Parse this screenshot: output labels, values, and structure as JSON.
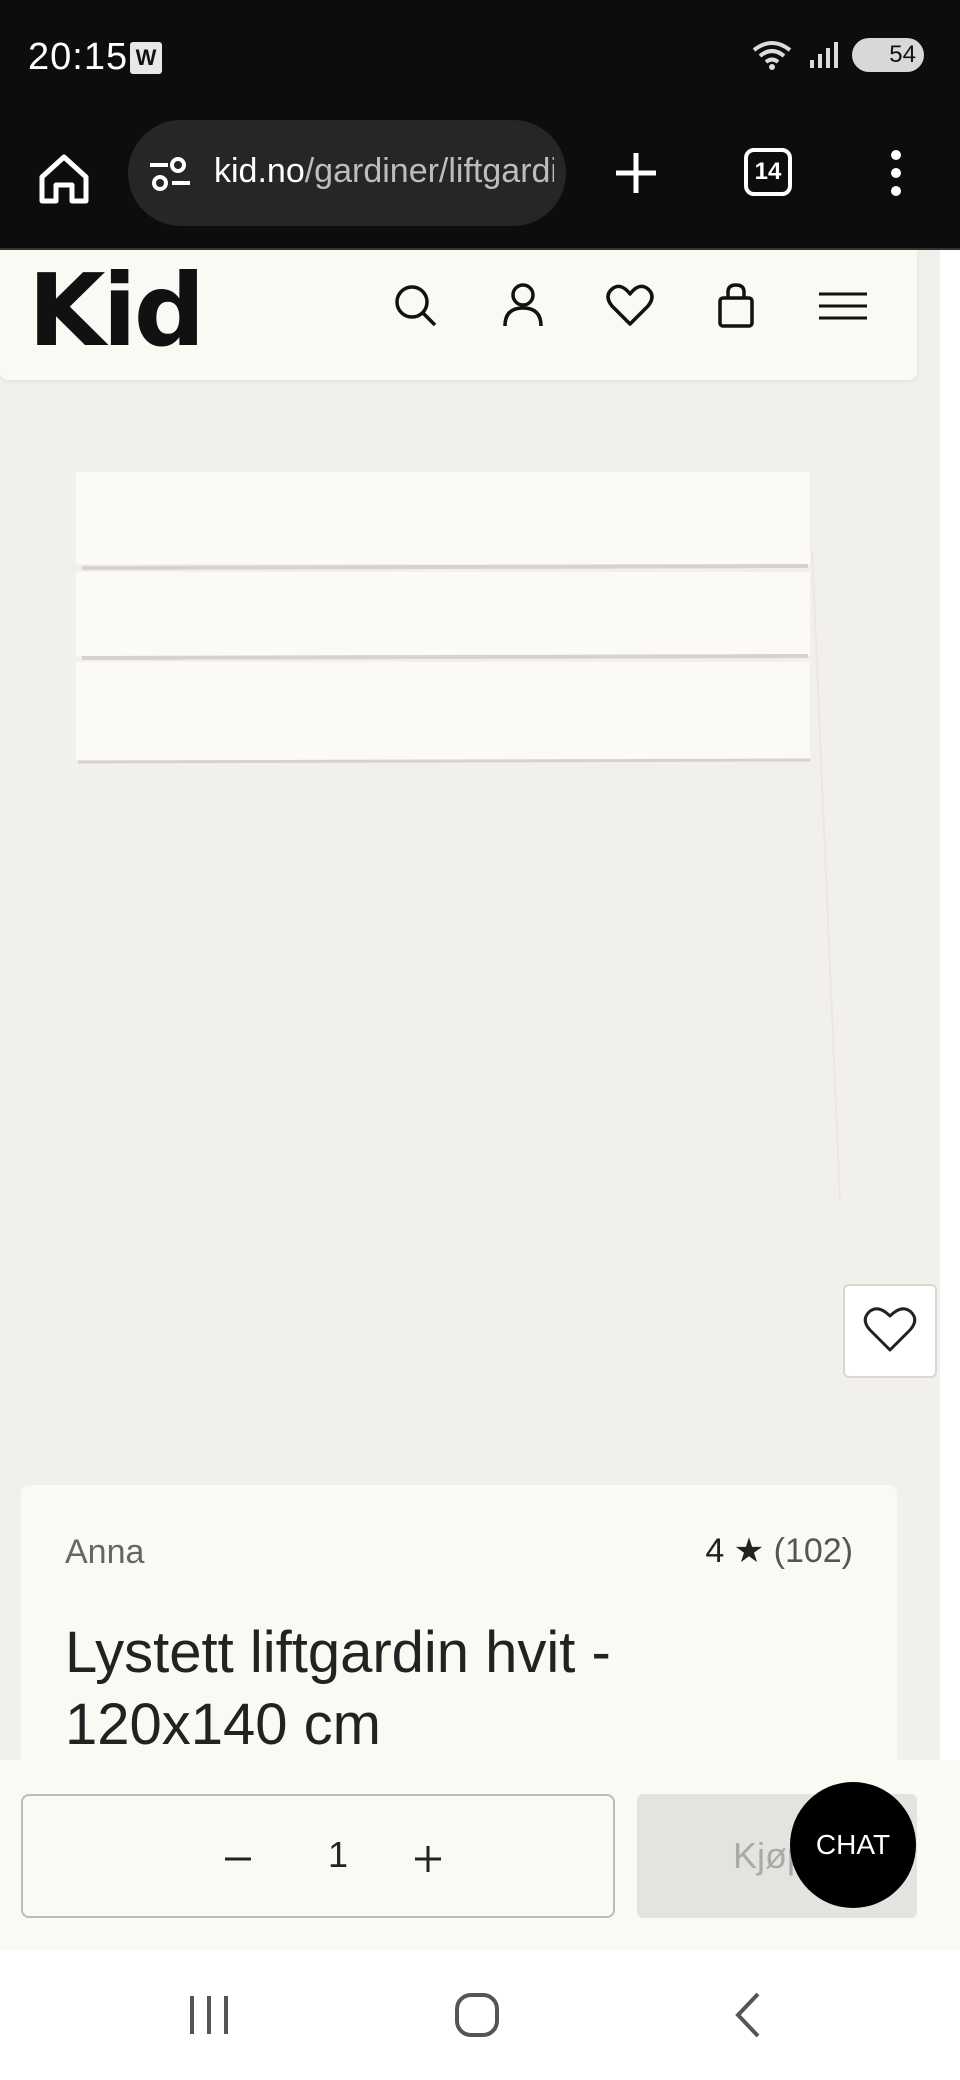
{
  "status_bar": {
    "time": "20:15",
    "app_badge": "W",
    "battery": "54"
  },
  "browser": {
    "url_host": "kid.no",
    "url_path": "/gardiner/liftgardin",
    "tab_count": "14"
  },
  "site": {
    "logo": "Kid"
  },
  "product": {
    "brand": "Anna",
    "rating_value": "4",
    "rating_star": "★",
    "rating_count": "(102)",
    "title": "Lystett liftgardin hvit - 120x140 cm"
  },
  "purchase": {
    "quantity": "1",
    "buy_label": "Kjøp",
    "chat_label": "CHAT"
  },
  "colors": {
    "page_bg": "#f2f0eb",
    "card_bg": "#faf9f4",
    "chrome_bg": "#0d0d0d",
    "text": "#1d1d26"
  }
}
